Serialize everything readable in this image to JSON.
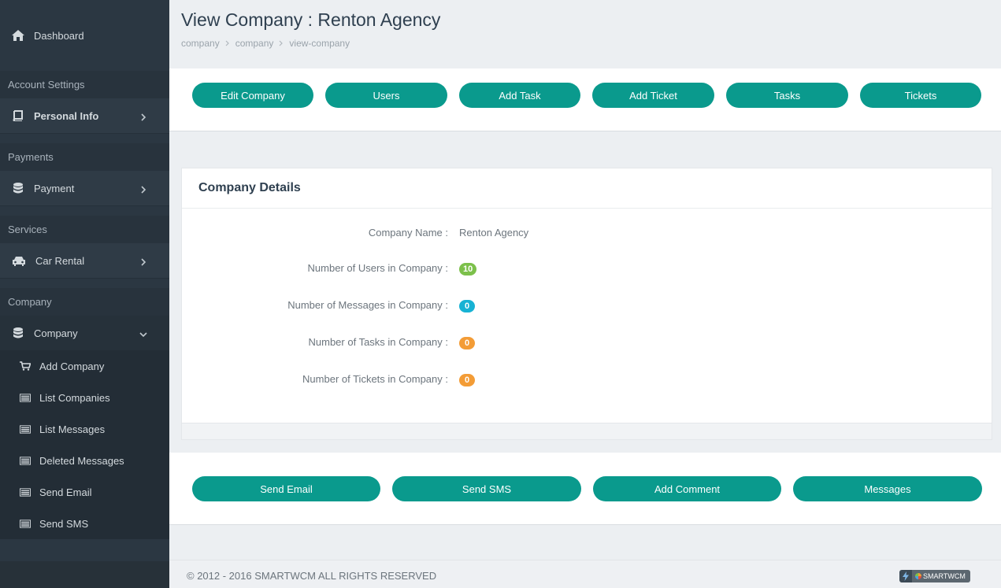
{
  "sidebar": {
    "dashboard": "Dashboard",
    "sections": {
      "account": "Account Settings",
      "payments": "Payments",
      "services": "Services",
      "company": "Company"
    },
    "items": {
      "personal_info": "Personal Info",
      "payment": "Payment",
      "car_rental": "Car Rental",
      "company": "Company"
    },
    "company_sub": [
      "Add Company",
      "List Companies",
      "List Messages",
      "Deleted Messages",
      "Send Email",
      "Send SMS"
    ]
  },
  "header": {
    "title": "View Company : Renton Agency",
    "breadcrumb": [
      "company",
      "company",
      "view-company"
    ]
  },
  "top_buttons": [
    "Edit Company",
    "Users",
    "Add Task",
    "Add Ticket",
    "Tasks",
    "Tickets"
  ],
  "details": {
    "title": "Company Details",
    "rows": [
      {
        "label": "Company Name :",
        "value": "Renton Agency"
      },
      {
        "label": "Number of Users in Company :",
        "value": "10",
        "badge_color": "#7cc04b"
      },
      {
        "label": "Number of Messages in Company :",
        "value": "0",
        "badge_color": "#17b2d4"
      },
      {
        "label": "Number of Tasks in Company :",
        "value": "0",
        "badge_color": "#f39c36"
      },
      {
        "label": "Number of Tickets in Company :",
        "value": "0",
        "badge_color": "#f39c36"
      }
    ]
  },
  "bottom_buttons": [
    "Send Email",
    "Send SMS",
    "Add Comment",
    "Messages"
  ],
  "footer": {
    "copyright": "© 2012 - 2016 SMARTWCM ALL RIGHTS RESERVED",
    "brand": "SMARTWCM"
  },
  "colors": {
    "sidebar": "#2b3742",
    "accent": "#0a9a8d",
    "badge_green": "#7cc04b",
    "badge_cyan": "#17b2d4",
    "badge_orange": "#f39c36"
  }
}
